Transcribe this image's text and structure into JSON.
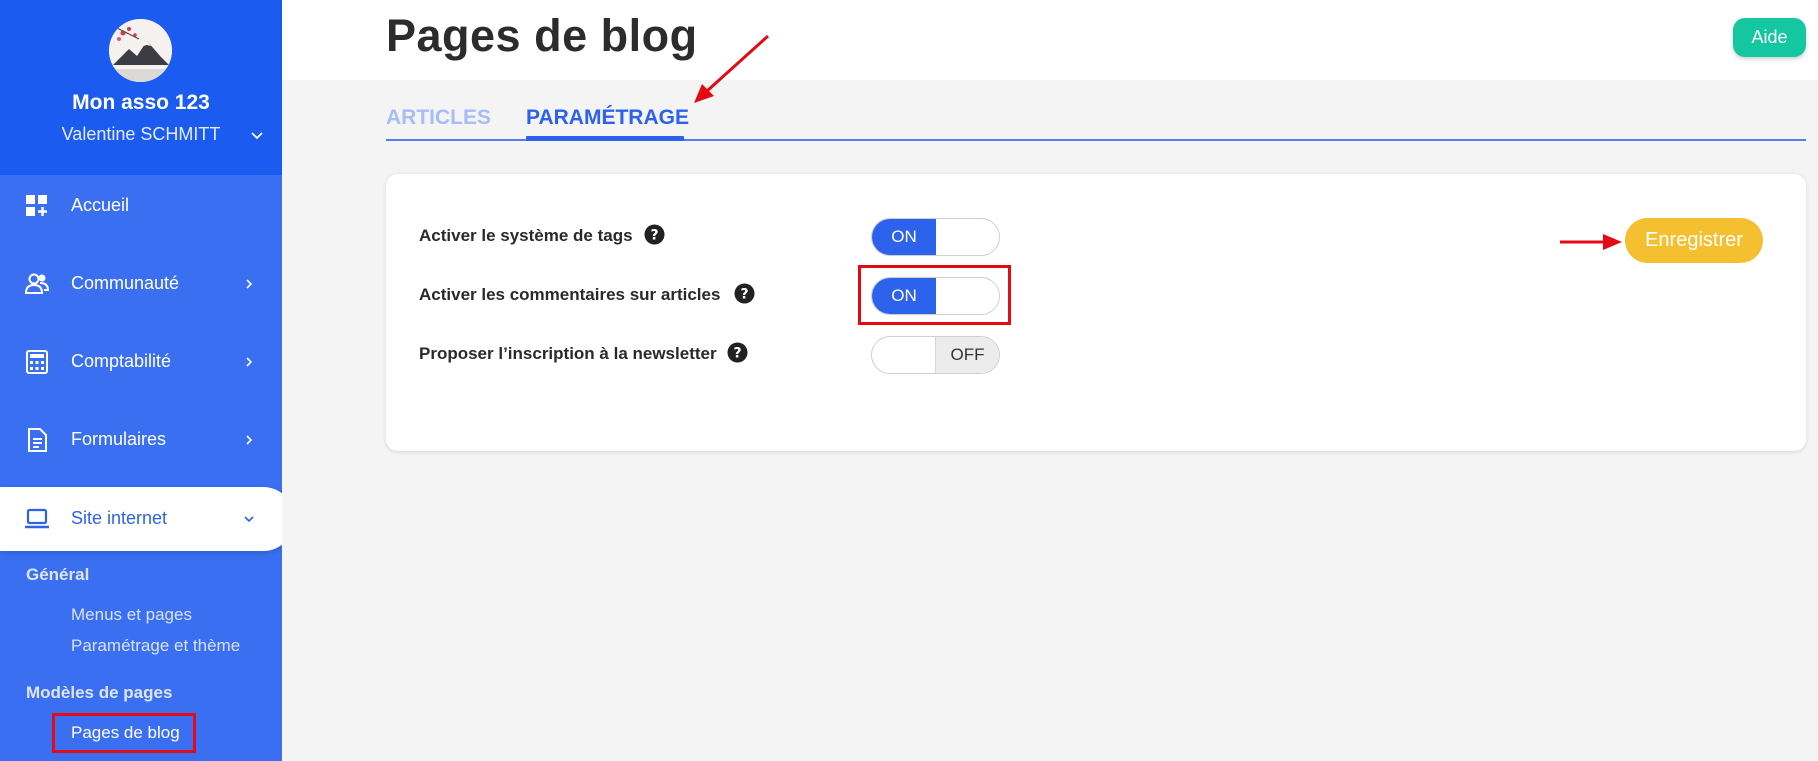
{
  "sidebar": {
    "org_name": "Mon asso 123",
    "user_name": "Valentine SCHMITT",
    "nav": [
      {
        "label": "Accueil",
        "icon": "dashboard-add-icon"
      },
      {
        "label": "Communauté",
        "icon": "users-icon"
      },
      {
        "label": "Comptabilité",
        "icon": "calculator-icon"
      },
      {
        "label": "Formulaires",
        "icon": "document-icon"
      },
      {
        "label": "Site internet",
        "icon": "laptop-icon"
      }
    ],
    "sub": {
      "general_heading": "Général",
      "general_links": [
        "Menus et pages",
        "Paramétrage et thème"
      ],
      "templates_heading": "Modèles de pages",
      "templates_links": [
        "Pages de blog"
      ]
    }
  },
  "header": {
    "title": "Pages de blog",
    "help_label": "Aide"
  },
  "tabs": [
    {
      "label": "ARTICLES",
      "active": false
    },
    {
      "label": "PARAMÉTRAGE",
      "active": true
    }
  ],
  "settings": {
    "items": [
      {
        "label": "Activer le système de tags",
        "state": "ON"
      },
      {
        "label": "Activer les commentaires sur articles",
        "state": "ON"
      },
      {
        "label": "Proposer l’inscription à la newsletter",
        "state": "OFF"
      }
    ],
    "save_label": "Enregistrer"
  },
  "colors": {
    "sidebar": "#3a6ff2",
    "sidebar_header": "#1c5bf0",
    "accent": "#2d62ec",
    "help_button": "#14c7a0",
    "save_button": "#f5c030",
    "annotation": "#e50914"
  }
}
